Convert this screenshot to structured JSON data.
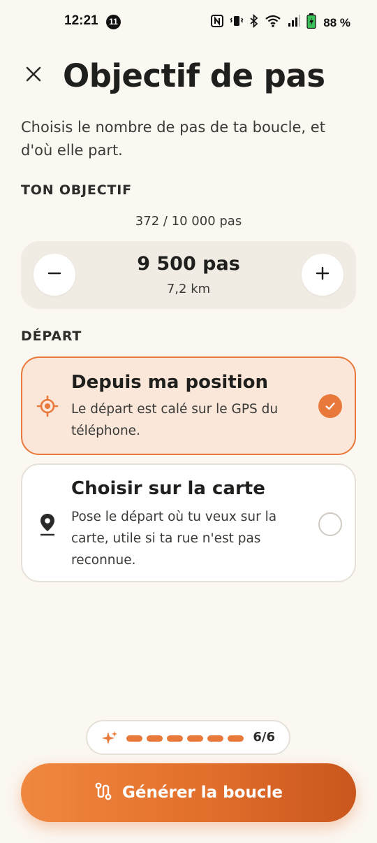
{
  "status_bar": {
    "time": "12:21",
    "notification_count": "11",
    "battery": "88 %"
  },
  "header": {
    "title": "Objectif de pas",
    "subtitle": "Choisis le nombre de pas de ta boucle, et d'où elle part."
  },
  "goal": {
    "section_label": "TON OBJECTIF",
    "progress": "372 / 10 000 pas",
    "value": "9 500 pas",
    "distance": "7,2 km"
  },
  "departure": {
    "section_label": "DÉPART",
    "options": [
      {
        "title": "Depuis ma position",
        "description": "Le départ est calé sur le GPS du téléphone.",
        "selected": true,
        "icon": "gps-target-icon"
      },
      {
        "title": "Choisir sur la carte",
        "description": "Pose le départ où tu veux sur la carte, utile si ta rue n'est pas reconnue.",
        "selected": false,
        "icon": "map-pin-icon"
      }
    ]
  },
  "steps_indicator": {
    "count": "6/6",
    "total": 6,
    "completed": 6
  },
  "cta": {
    "label": "Générer la boucle",
    "icon": "route-icon"
  },
  "colors": {
    "accent": "#E8793A",
    "background": "#FBF7F1",
    "selected_card": "#FBE7DA"
  }
}
